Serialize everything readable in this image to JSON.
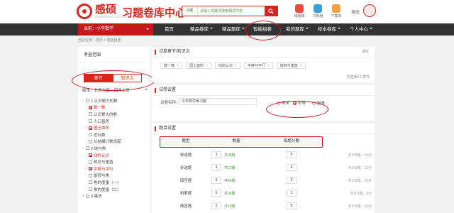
{
  "header": {
    "logo_text": "感硕",
    "logo_sub": "GANSHUO EDUC",
    "site_title": "习题卷库中心",
    "search": {
      "type": "试卷",
      "placeholder": "请输入关键词搜索相关内容"
    },
    "tools": [
      {
        "label": "错题库",
        "color": "#e94b3c"
      },
      {
        "label": "习题组",
        "color": "#3aa0dc"
      },
      {
        "label": "下载库",
        "color": "#f2a23a"
      }
    ],
    "user_name": "退出"
  },
  "nav": {
    "current": "当前：小学数学",
    "items": [
      "首页",
      "精品卷库",
      "精品题库",
      "智能组卷",
      "我的题库",
      "校本卷库",
      "个人中心"
    ]
  },
  "breadcrumb": "当前位置：首页 > 智能组卷",
  "sidebar": {
    "title": "考查范围",
    "tab_chapter": "章节",
    "tab_knowledge": "知识点",
    "version": "版本：北师大版 > 四年上册",
    "tree": [
      {
        "label": "1.认识更大的数",
        "level": 1,
        "toggle": "−",
        "checked": false
      },
      {
        "label": "数一数",
        "level": 2,
        "checked": true
      },
      {
        "label": "认识更大的数",
        "level": 2,
        "checked": false
      },
      {
        "label": "人口普查",
        "level": 2,
        "checked": false
      },
      {
        "label": "国土面积",
        "level": 2,
        "checked": true
      },
      {
        "label": "近似数",
        "level": 2,
        "checked": false
      },
      {
        "label": "从结绳计数说起",
        "level": 2,
        "checked": false
      },
      {
        "label": "2.线与角",
        "level": 1,
        "toggle": "−",
        "checked": false
      },
      {
        "label": "线的认识",
        "level": 2,
        "checked": true
      },
      {
        "label": "相交与垂直",
        "level": 2,
        "checked": false
      },
      {
        "label": "平移与平行",
        "level": 2,
        "checked": true
      },
      {
        "label": "旋转与角",
        "level": 2,
        "checked": false
      },
      {
        "label": "角的度量（一）",
        "level": 2,
        "checked": false
      },
      {
        "label": "角的度量（二）",
        "level": 2,
        "checked": false
      },
      {
        "label": "3.乘法",
        "level": 1,
        "toggle": "+",
        "checked": false
      }
    ]
  },
  "scope_panel": {
    "title": "试卷章节/知识点",
    "clear": "清空",
    "tags": [
      "数一数",
      "国土面积",
      "线的认识",
      "平移与平行",
      "旋转与角度"
    ],
    "selected": "已选择5个章节"
  },
  "settings_panel": {
    "title": "试卷设置",
    "name_label": "试卷名称：",
    "name_value": "小学数学练习题",
    "difficulty": [
      "简单",
      "中等",
      "困难"
    ],
    "difficulty_selected": 1
  },
  "questions_panel": {
    "title": "题目设置",
    "headers": [
      "题型",
      "数量",
      "每题分数"
    ],
    "rows": [
      {
        "type": "单选题",
        "count": "3",
        "available": "共35题",
        "score": "5",
        "total": "共计3题，15分"
      },
      {
        "type": "多选题",
        "count": "3",
        "available": "共12题",
        "score": "4",
        "total": "共计3题，12分"
      },
      {
        "type": "填空题",
        "count": "5",
        "available": "共40题",
        "score": "2",
        "total": "共计5题，10分"
      },
      {
        "type": "判断题",
        "count": "5",
        "available": "共36题",
        "score": "1",
        "total": "共计5题，5分"
      },
      {
        "type": "简答题",
        "count": "2",
        "available": "共18题",
        "score": "5",
        "total": "共计2题，10分"
      }
    ]
  }
}
